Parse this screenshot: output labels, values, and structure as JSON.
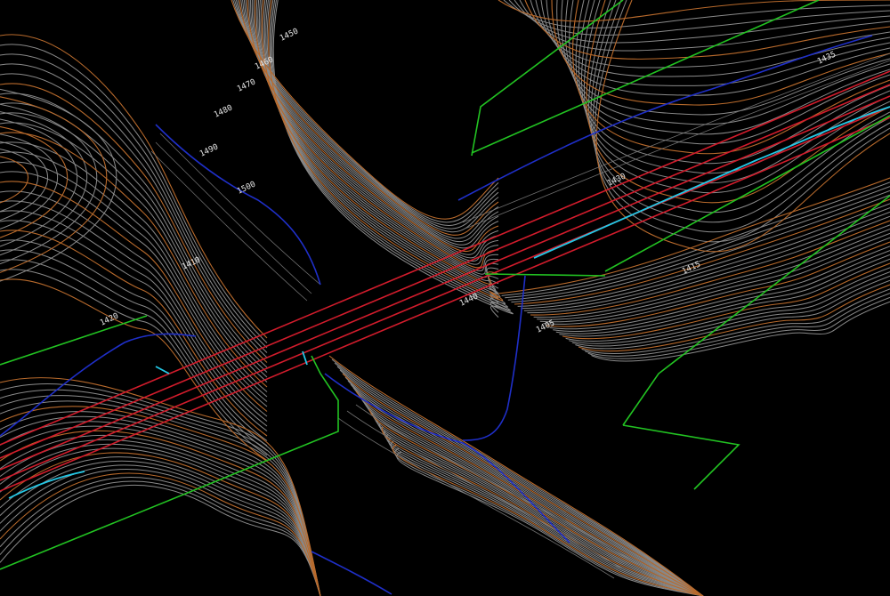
{
  "map": {
    "background": "#000000",
    "layer_colors": {
      "contour_minor": "#8a8a8a",
      "contour_major": "#b86a2c",
      "road_centerline": "#d21c2c",
      "stream": "#1f2fc8",
      "boundary": "#22c322",
      "water_edge": "#23c8e6"
    },
    "elevation_labels": [
      "1450",
      "1460",
      "1470",
      "1480",
      "1490",
      "1500",
      "1410",
      "1420",
      "1430",
      "1440",
      "1405",
      "1415",
      "1435"
    ]
  }
}
